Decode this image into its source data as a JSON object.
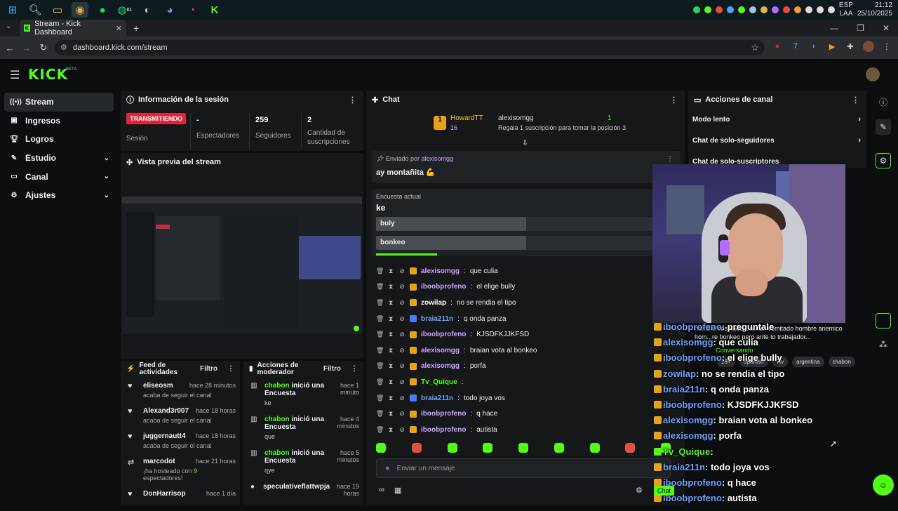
{
  "taskbar": {
    "icons": [
      "windows-start-icon",
      "search-icon",
      "file-explorer-icon",
      "chrome-icon",
      "spotify-icon",
      "whatsapp-icon",
      "steam-icon",
      "discord-icon",
      "app-icon",
      "kick-icon"
    ],
    "whatsapp_badge": "61",
    "lang_top": "ESP",
    "lang_bottom": "LAA",
    "time": "21:12",
    "date": "25/10/2025"
  },
  "browser": {
    "tab_title": "Stream - Kick Dashboard",
    "url": "dashboard.kick.com/stream"
  },
  "kick": {
    "logo": "KICK",
    "beta": "BETA"
  },
  "sidebar": {
    "items": [
      {
        "label": "Stream",
        "icon": "broadcast-icon"
      },
      {
        "label": "Ingresos",
        "icon": "revenue-icon"
      },
      {
        "label": "Logros",
        "icon": "trophy-icon"
      },
      {
        "label": "Estudio",
        "icon": "studio-icon"
      },
      {
        "label": "Canal",
        "icon": "channel-icon"
      },
      {
        "label": "Ajustes",
        "icon": "gear-icon"
      }
    ]
  },
  "session": {
    "title": "Información de la sesión",
    "live_badge": "TRANSMITIENDO",
    "session_label": "Sesión",
    "viewers_value": "-",
    "viewers_label": "Espectadores",
    "followers_value": "259",
    "followers_label": "Seguidores",
    "subs_value": "2",
    "subs_label": "Cantidad de suscripciones"
  },
  "preview": {
    "title": "Vista previa del stream"
  },
  "feed": {
    "title": "Feed de actividades",
    "filter": "Filtro",
    "items": [
      {
        "name": "eliseosm",
        "time": "hace 28 minutos",
        "sub": "acaba de seguir el canal"
      },
      {
        "name": "Alexand3r007",
        "time": "hace 18 horas",
        "sub": "acaba de seguir el canal"
      },
      {
        "name": "juggernautt4",
        "time": "hace 18 horas",
        "sub": "acaba de seguir el canal"
      },
      {
        "name": "marcodot",
        "time": "hace 21 horas",
        "sub_pre": "¡ha hosteado con ",
        "sub_num": "9",
        "sub_post": " espectadores!"
      },
      {
        "name": "DonHarrisop",
        "time": "hace 1 día",
        "sub": ""
      }
    ]
  },
  "mod": {
    "title": "Acciones de moderador",
    "filter": "Filtro",
    "items": [
      {
        "user": "chabon",
        "action": " inició una Encuesta",
        "sub": "ke",
        "time": "hace 1 minuto"
      },
      {
        "user": "chabon",
        "action": " inició una Encuesta",
        "sub": "que",
        "time": "hace 4 minutos"
      },
      {
        "user": "chabon",
        "action": " inició una Encuesta",
        "sub": "qye",
        "time": "hace 5 minutos"
      },
      {
        "user": "speculativeflattwpja",
        "action": "",
        "sub": "",
        "time": "hace 19 horas"
      }
    ]
  },
  "chat": {
    "title": "Chat",
    "gift": {
      "name": "HowardTT",
      "count": "16",
      "user": "alexisomgg",
      "message": "Regala 1 suscripción para tomar la posición 3",
      "rank": "1"
    },
    "pinned": {
      "by_label": "Enviado por",
      "by_user": "alexisomgg",
      "message": "ay montañita 💪"
    },
    "poll": {
      "label": "Encuesta actual",
      "title": "ke",
      "options": [
        {
          "text": "buly",
          "count": "5",
          "fraction": 0.54
        },
        {
          "text": "bonkeo",
          "count": "5",
          "fraction": 0.54
        }
      ],
      "remaining": 0.22
    },
    "messages": [
      {
        "user": "alexisomgg",
        "text": "que culia",
        "color": "#c9a6ff"
      },
      {
        "user": "iboobprofeno",
        "text": "el elige bully",
        "color": "#c9a6ff"
      },
      {
        "user": "zowilap",
        "text": "no se rendia el tipo",
        "color": "#ffffff"
      },
      {
        "user": "braia211n",
        "text": "q onda panza",
        "color": "#6fa3ff"
      },
      {
        "user": "iboobprofeno",
        "text": "KJSDFKJJKFSD",
        "color": "#c9a6ff"
      },
      {
        "user": "alexisomgg",
        "text": "braian vota al bonkeo",
        "color": "#c9a6ff"
      },
      {
        "user": "alexisomgg",
        "text": "porfa",
        "color": "#c9a6ff"
      },
      {
        "user": "Tv_Quique",
        "text": "",
        "color": "#53fc18"
      },
      {
        "user": "braia211n",
        "text": "todo joya vos",
        "color": "#6fa3ff"
      },
      {
        "user": "iboobprofeno",
        "text": "q hace",
        "color": "#c9a6ff"
      },
      {
        "user": "iboobprofeno",
        "text": "autista",
        "color": "#c9a6ff"
      }
    ],
    "input_placeholder": "Enviar un mensaje"
  },
  "actions": {
    "title": "Acciones de canal",
    "rows": [
      "Modo lento",
      "Chat de solo-seguidores",
      "Chat de solo-suscriptores"
    ]
  },
  "overlay": {
    "notice": "nombre cosplaee... temer vomitado hombre anemico hom...re bonkeo pero ante to trabajador...",
    "conversando": "Conversando",
    "tags": [
      "18+",
      "Spanish",
      "7tv",
      "argentina",
      "chabon"
    ],
    "lines": [
      {
        "user": "iboobprofeno",
        "text": "preguntale"
      },
      {
        "user": "alexisomgg",
        "text": "que culia"
      },
      {
        "user": "iboobprofeno",
        "text": "el elige bully"
      },
      {
        "user": "zowilap",
        "text": "no se rendia el tipo"
      },
      {
        "user": "braia211n",
        "text": "q onda panza"
      },
      {
        "user": "iboobprofeno",
        "text": "KJSDFKJJKFSD"
      },
      {
        "user": "alexisomgg",
        "text": "braian vota al bonkeo"
      },
      {
        "user": "alexisomgg",
        "text": "porfa"
      },
      {
        "user": "Tv_Quique",
        "text": ""
      },
      {
        "user": "braia211n",
        "text": "todo joya vos"
      },
      {
        "user": "iboobprofeno",
        "text": "q hace"
      },
      {
        "user": "iboobprofeno",
        "text": "autista"
      }
    ],
    "chat_label": "Chat"
  },
  "colors": {
    "kick_green": "#53fc18",
    "live_red": "#e0243b",
    "gold": "#e8a21a"
  }
}
